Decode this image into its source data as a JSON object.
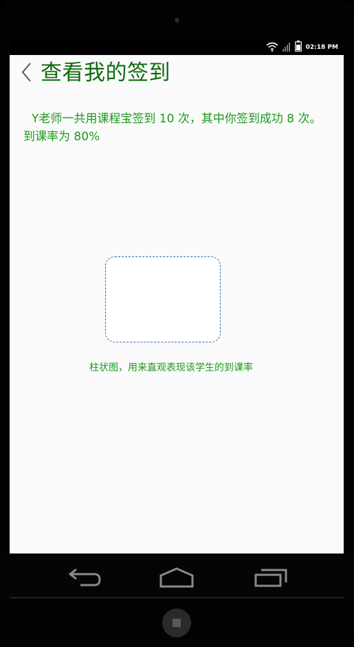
{
  "status_bar": {
    "time": "02:18 PM",
    "icons": [
      "wifi-icon",
      "signal-icon",
      "battery-icon"
    ]
  },
  "header": {
    "back_icon": "chevron-left-icon",
    "title": "查看我的签到"
  },
  "content": {
    "summary": "Y老师一共用课程宝签到 10 次，其中你签到成功 8 次。到课率为 80%",
    "chart_placeholder_caption": "柱状图，用来直观表现该学生的到课率"
  },
  "nav_bar": {
    "back_icon": "back-arrow-icon",
    "home_icon": "home-icon",
    "recents_icon": "recent-apps-icon"
  },
  "colors": {
    "title": "#0d6b0d",
    "text": "#1c9a1c",
    "chart_border": "#2d6aa6",
    "screen_bg": "#fafafa"
  }
}
